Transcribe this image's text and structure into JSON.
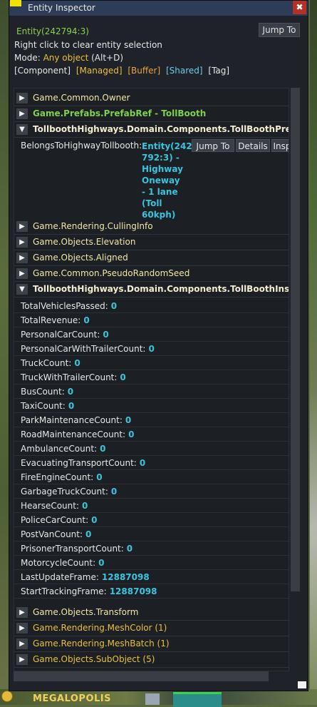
{
  "window": {
    "title": "Entity Inspector"
  },
  "header": {
    "entity_id": "Entity(242794:3)",
    "jump_to": "Jump To",
    "hint": "Right click to clear entity selection",
    "mode_label": "Mode:",
    "mode_value": "Any object",
    "mode_shortcut": "(Alt+D)",
    "filters": [
      "[Component]",
      "[Managed]",
      "[Buffer]",
      "[Shared]",
      "[Tag]"
    ]
  },
  "components_top": [
    {
      "label": "Game.Common.Owner",
      "expanded": false,
      "style": "yellow"
    },
    {
      "label": "Game.Prefabs.PrefabRef - TollBooth",
      "expanded": false,
      "style": "green"
    },
    {
      "label": "TollboothHighways.Domain.Components.TollBoothPrefab",
      "expanded": true,
      "style": "bold"
    }
  ],
  "prefab_detail": {
    "label": "BelongsToHighwayTollbooth:",
    "link": "Entity(242 792:3)  - Highway Oneway - 1 lane (Toll 60kph)",
    "buttons": [
      "Jump To",
      "Details",
      "Insp"
    ]
  },
  "components_mid": [
    {
      "label": "Game.Rendering.CullingInfo",
      "expanded": false,
      "style": "yellow"
    },
    {
      "label": "Game.Objects.Elevation",
      "expanded": false,
      "style": "yellow"
    },
    {
      "label": "Game.Objects.Aligned",
      "expanded": false,
      "style": "yellow"
    },
    {
      "label": "Game.Common.PseudoRandomSeed",
      "expanded": false,
      "style": "yellow"
    },
    {
      "label": "TollboothHighways.Domain.Components.TollBoothInsight",
      "expanded": true,
      "style": "bold"
    }
  ],
  "insight_fields": [
    {
      "name": "TotalVehiclesPassed:",
      "value": "0"
    },
    {
      "name": "TotalRevenue:",
      "value": "0"
    },
    {
      "name": "PersonalCarCount:",
      "value": "0"
    },
    {
      "name": "PersonalCarWithTrailerCount:",
      "value": "0"
    },
    {
      "name": "TruckCount:",
      "value": "0"
    },
    {
      "name": "TruckWithTrailerCount:",
      "value": "0"
    },
    {
      "name": "BusCount:",
      "value": "0"
    },
    {
      "name": "TaxiCount:",
      "value": "0"
    },
    {
      "name": "ParkMaintenanceCount:",
      "value": "0"
    },
    {
      "name": "RoadMaintenanceCount:",
      "value": "0"
    },
    {
      "name": "AmbulanceCount:",
      "value": "0"
    },
    {
      "name": "EvacuatingTransportCount:",
      "value": "0"
    },
    {
      "name": "FireEngineCount:",
      "value": "0"
    },
    {
      "name": "GarbageTruckCount:",
      "value": "0"
    },
    {
      "name": "HearseCount:",
      "value": "0"
    },
    {
      "name": "PoliceCarCount:",
      "value": "0"
    },
    {
      "name": "PostVanCount:",
      "value": "0"
    },
    {
      "name": "PrisonerTransportCount:",
      "value": "0"
    },
    {
      "name": "MotorcycleCount:",
      "value": "0"
    },
    {
      "name": "LastUpdateFrame:",
      "value": "12887098"
    },
    {
      "name": "StartTrackingFrame:",
      "value": "12887098"
    }
  ],
  "components_bottom": [
    {
      "label": "Game.Objects.Transform",
      "expanded": false,
      "style": "yellow"
    },
    {
      "label": "Game.Rendering.MeshColor (1)",
      "expanded": false,
      "style": "gold"
    },
    {
      "label": "Game.Rendering.MeshBatch (1)",
      "expanded": false,
      "style": "gold"
    },
    {
      "label": "Game.Objects.SubObject (5)",
      "expanded": false,
      "style": "gold"
    }
  ],
  "game_bar": {
    "city_name": "MEGALOPOLIS"
  },
  "icons": {
    "collapsed": "triangle-right-icon",
    "expanded": "triangle-down-icon",
    "close": "close-icon"
  },
  "colors": {
    "accent_green": "#7fd14a",
    "value_cyan": "#39c4dd",
    "gold": "#e8c13a",
    "close_red": "#b53128"
  }
}
